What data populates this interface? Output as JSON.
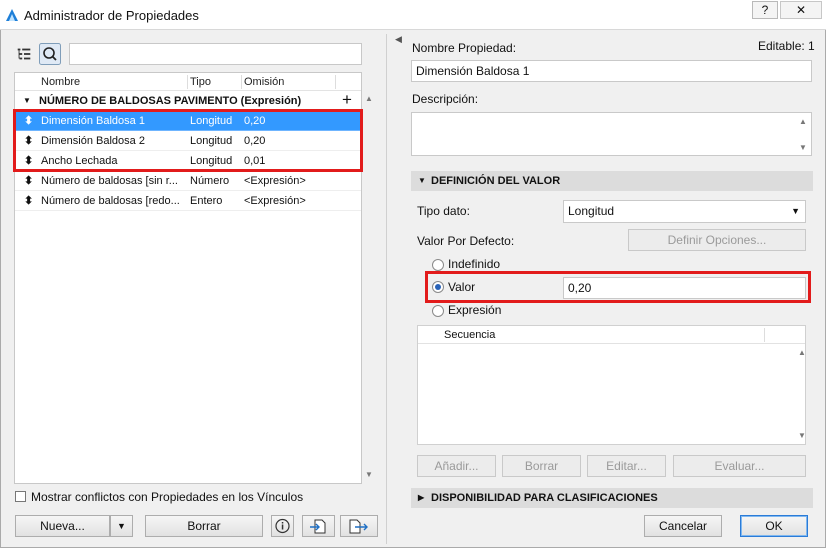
{
  "window": {
    "title": "Administrador de Propiedades",
    "help_label": "?",
    "close_label": "✕"
  },
  "left": {
    "columns": {
      "name": "Nombre",
      "type": "Tipo",
      "default": "Omisión"
    },
    "group_label": "NÚMERO DE BALDOSAS PAVIMENTO (Expresión)",
    "add_symbol": "+",
    "rows": [
      {
        "name": "Dimensión Baldosa 1",
        "type": "Longitud",
        "default": "0,20",
        "selected": true
      },
      {
        "name": "Dimensión Baldosa 2",
        "type": "Longitud",
        "default": "0,20",
        "selected": false
      },
      {
        "name": "Ancho Lechada",
        "type": "Longitud",
        "default": "0,01",
        "selected": false
      },
      {
        "name": "Número de baldosas [sin r...",
        "type": "Número",
        "default": "<Expresión>",
        "selected": false
      },
      {
        "name": "Número de baldosas [redo...",
        "type": "Entero",
        "default": "<Expresión>",
        "selected": false
      }
    ],
    "show_conflicts_label": "Mostrar conflictos con Propiedades en los Vínculos",
    "new_button": "Nueva...",
    "delete_button": "Borrar"
  },
  "right": {
    "property_name_label": "Nombre Propiedad:",
    "editable_label": "Editable: 1",
    "property_name_value": "Dimensión Baldosa 1",
    "description_label": "Descripción:",
    "description_value": "",
    "value_section_label": "DEFINICIÓN DEL VALOR",
    "data_type_label": "Tipo dato:",
    "data_type_value": "Longitud",
    "default_value_label": "Valor Por Defecto:",
    "define_options_button": "Definir Opciones...",
    "radio_undefined": "Indefinido",
    "radio_value": "Valor",
    "value_input": "0,20",
    "radio_expression": "Expresión",
    "sequence_header": "Secuencia",
    "add_button": "Añadir...",
    "delete_button": "Borrar",
    "edit_button": "Editar...",
    "evaluate_button": "Evaluar...",
    "availability_section_label": "DISPONIBILIDAD PARA CLASIFICACIONES",
    "cancel_button": "Cancelar",
    "ok_button": "OK"
  },
  "colors": {
    "selection": "#3399ff",
    "highlight": "#e21b1b"
  }
}
